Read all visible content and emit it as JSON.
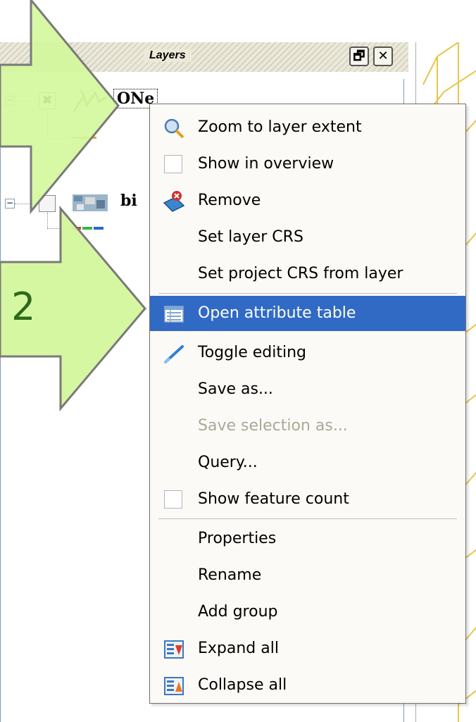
{
  "panel": {
    "title": "Layers",
    "restore_label": "🗗",
    "close_label": "✕"
  },
  "layers": [
    {
      "name": "ONe",
      "checked": true,
      "expanded": true
    },
    {
      "name": "bi",
      "checked": false,
      "expanded": true
    }
  ],
  "context_menu": {
    "items": [
      {
        "label": "Zoom to layer extent",
        "icon": "zoom-extent-icon",
        "enabled": true
      },
      {
        "label": "Show in overview",
        "icon": "checkbox",
        "enabled": true
      },
      {
        "label": "Remove",
        "icon": "remove-layer-icon",
        "enabled": true
      },
      {
        "label": "Set layer CRS",
        "icon": "",
        "enabled": true
      },
      {
        "label": "Set project CRS from layer",
        "icon": "",
        "enabled": true
      },
      {
        "label": "Open attribute table",
        "icon": "attribute-table-icon",
        "enabled": true,
        "highlighted": true
      },
      {
        "label": "Toggle editing",
        "icon": "pencil-icon",
        "enabled": true
      },
      {
        "label": "Save as...",
        "icon": "",
        "enabled": true
      },
      {
        "label": "Save selection as...",
        "icon": "",
        "enabled": false
      },
      {
        "label": "Query...",
        "icon": "",
        "enabled": true
      },
      {
        "label": "Show feature count",
        "icon": "checkbox",
        "enabled": true
      },
      {
        "label": "Properties",
        "icon": "",
        "enabled": true
      },
      {
        "label": "Rename",
        "icon": "",
        "enabled": true
      },
      {
        "label": "Add group",
        "icon": "",
        "enabled": true
      },
      {
        "label": "Expand all",
        "icon": "expand-all-icon",
        "enabled": true
      },
      {
        "label": "Collapse all",
        "icon": "collapse-all-icon",
        "enabled": true
      }
    ]
  },
  "annotation": {
    "step_label": "2",
    "arrow_color": "#d4f79c",
    "arrow_stroke": "#7a7a7a"
  },
  "colors": {
    "highlight": "#316ac5",
    "panel_title_bg": "#ece9d8",
    "menu_bg": "#fbfaf6",
    "map_line": "#e8c547"
  }
}
